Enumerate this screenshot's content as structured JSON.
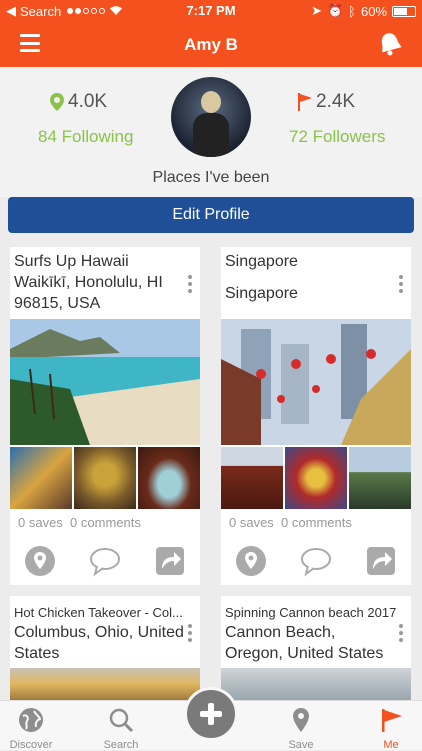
{
  "status": {
    "carrier": "Search",
    "time": "7:17 PM",
    "battery": "60%"
  },
  "header": {
    "title": "Amy B"
  },
  "profile": {
    "visits": "4.0K",
    "flags": "2.4K",
    "following": "84 Following",
    "followers": "72 Followers",
    "places_label": "Places I've been",
    "edit_label": "Edit Profile"
  },
  "cards": [
    {
      "name": "Surfs Up Hawaii",
      "address": "Waikīkī, Honolulu, HI 96815, USA",
      "saves": "0 saves",
      "comments": "0 comments"
    },
    {
      "name": "Singapore",
      "address": "Singapore",
      "saves": "0 saves",
      "comments": "0 comments"
    },
    {
      "name": "Hot Chicken Takeover - Col...",
      "address": "Columbus, Ohio, United States"
    },
    {
      "name": "Spinning Cannon beach 2017",
      "address": "Cannon Beach, Oregon, United States"
    }
  ],
  "tabs": [
    {
      "label": "Discover",
      "icon": "globe-icon"
    },
    {
      "label": "Search",
      "icon": "search-icon"
    },
    {
      "label": "Save",
      "icon": "map-pin-icon"
    },
    {
      "label": "Me",
      "icon": "flag-icon"
    }
  ],
  "colors": {
    "brand": "#f4511e",
    "button": "#1f4f96",
    "accent_green": "#8bc34a"
  }
}
